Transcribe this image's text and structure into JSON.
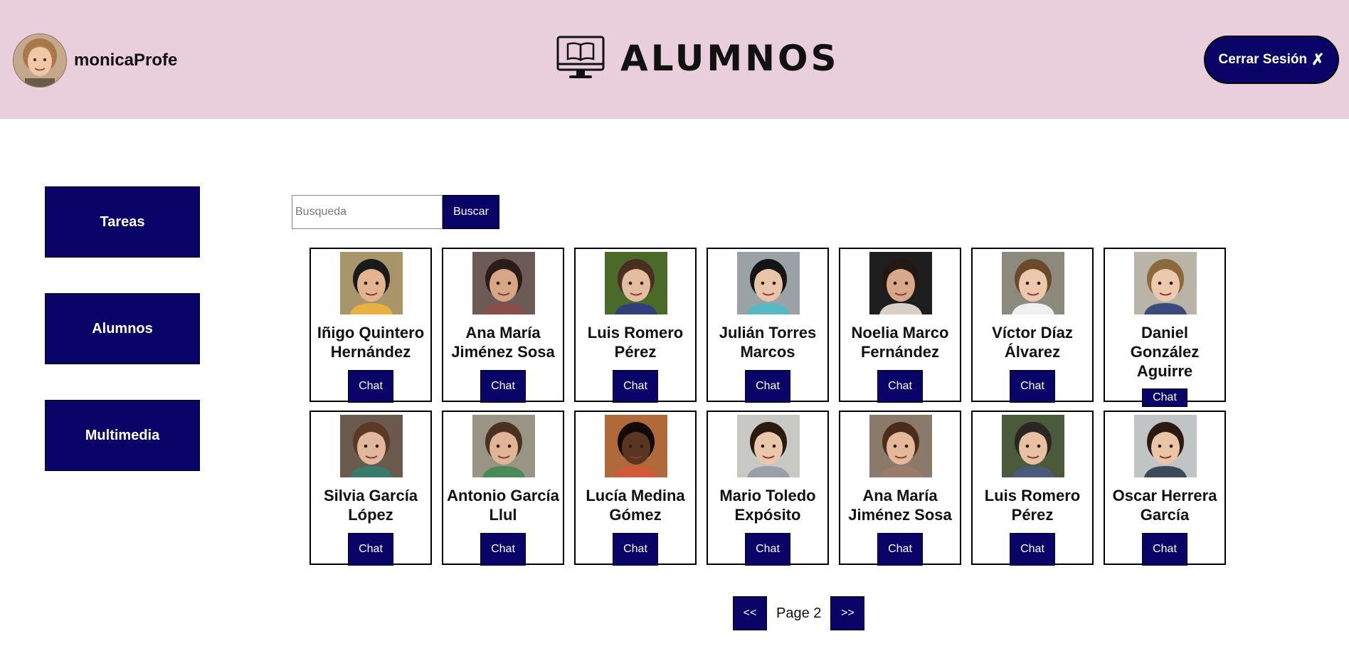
{
  "header": {
    "username": "monicaProfe",
    "title": "ALUMNOS",
    "logout_label": "Cerrar Sesión",
    "logout_icon": "✗"
  },
  "sidebar": {
    "items": [
      {
        "label": "Tareas"
      },
      {
        "label": "Alumnos"
      },
      {
        "label": "Multimedia"
      }
    ]
  },
  "search": {
    "placeholder": "Busqueda",
    "value": "",
    "button_label": "Buscar"
  },
  "students": [
    {
      "name": "Iñigo Quintero Hernández",
      "chat_label": "Chat",
      "skin": "#e2b48f",
      "hair": "#1a1a1a",
      "bg": "#a8956a",
      "shirt": "#e8b040"
    },
    {
      "name": "Ana María Jiménez Sosa",
      "chat_label": "Chat",
      "skin": "#d6a686",
      "hair": "#2a1c16",
      "bg": "#6b5a56",
      "shirt": "#8a4d4a"
    },
    {
      "name": "Luis Romero Pérez",
      "chat_label": "Chat",
      "skin": "#e4bda0",
      "hair": "#4a2f20",
      "bg": "#4a6a2a",
      "shirt": "#2e3f7a"
    },
    {
      "name": "Julián Torres Marcos",
      "chat_label": "Chat",
      "skin": "#e8c4a8",
      "hair": "#151515",
      "bg": "#9aa2a6",
      "shirt": "#58b8c4"
    },
    {
      "name": "Noelia Marco Fernández",
      "chat_label": "Chat",
      "skin": "#d8a88a",
      "hair": "#241812",
      "bg": "#1e1e1e",
      "shirt": "#d8d0c8"
    },
    {
      "name": "Víctor Díaz Álvarez",
      "chat_label": "Chat",
      "skin": "#ecc8ac",
      "hair": "#6a4a2a",
      "bg": "#8c8a7c",
      "shirt": "#f0f0f0"
    },
    {
      "name": "Daniel González Aguirre",
      "chat_label": "Chat",
      "skin": "#ecc8ac",
      "hair": "#8a6a3a",
      "bg": "#b8b4a8",
      "shirt": "#3a4a7a"
    },
    {
      "name": "Silvia García López",
      "chat_label": "Chat",
      "skin": "#e2b89c",
      "hair": "#5a3a24",
      "bg": "#6a5a4e",
      "shirt": "#3a7a6a"
    },
    {
      "name": "Antonio García Llul",
      "chat_label": "Chat",
      "skin": "#e0b496",
      "hair": "#4a3220",
      "bg": "#9a9484",
      "shirt": "#4a8a5a"
    },
    {
      "name": "Lucía Medina Gómez",
      "chat_label": "Chat",
      "skin": "#5a3622",
      "hair": "#120a08",
      "bg": "#b06a3a",
      "shirt": "#d05a3a"
    },
    {
      "name": "Mario Toledo Expósito",
      "chat_label": "Chat",
      "skin": "#eac6aa",
      "hair": "#2a1a10",
      "bg": "#c8c8c4",
      "shirt": "#9aa0a8"
    },
    {
      "name": "Ana María Jiménez Sosa",
      "chat_label": "Chat",
      "skin": "#e4b898",
      "hair": "#4a2c1a",
      "bg": "#8a7a6a",
      "shirt": "#9a7a6a"
    },
    {
      "name": "Luis Romero Pérez",
      "chat_label": "Chat",
      "skin": "#e8c0a2",
      "hair": "#2a2624",
      "bg": "#4a5a3a",
      "shirt": "#4a5a7a"
    },
    {
      "name": "Oscar Herrera García",
      "chat_label": "Chat",
      "skin": "#eac4a6",
      "hair": "#2a1a12",
      "bg": "#c0c4c4",
      "shirt": "#3a4a5a"
    }
  ],
  "pagination": {
    "prev_label": "<<",
    "page_label": "Page 2",
    "next_label": ">>"
  },
  "colors": {
    "header_bg": "#e8cfdb",
    "accent": "#0b0468"
  },
  "icons": {
    "logo": "book-monitor-icon",
    "logout": "x-mark-icon"
  }
}
